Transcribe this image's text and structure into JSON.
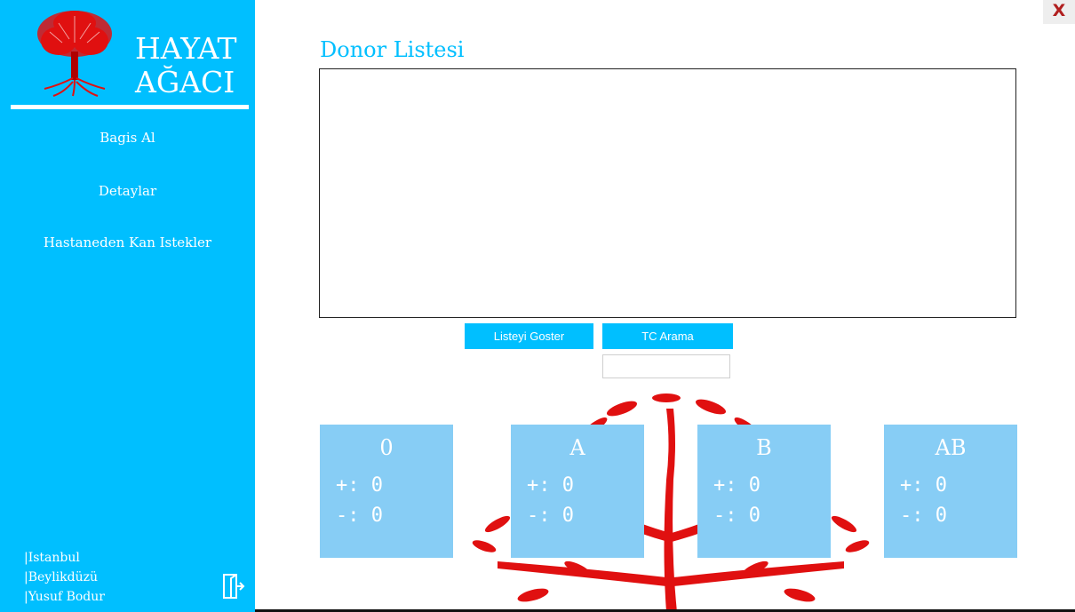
{
  "app": {
    "logo_line1": "HAYAT",
    "logo_line2": "AĞACI"
  },
  "sidebar": {
    "items": [
      {
        "label": "Bagis Al"
      },
      {
        "label": "Detaylar"
      },
      {
        "label": "Hastaneden Kan Istekler"
      }
    ],
    "footer": [
      "Istanbul",
      "Beylikdüzü",
      "Yusuf Bodur"
    ]
  },
  "window": {
    "close_label": "X"
  },
  "main": {
    "title": "Donor Listesi",
    "show_list_button": "Listeyi Goster",
    "tc_search_button": "TC Arama",
    "tc_input_value": ""
  },
  "blood_groups": [
    {
      "name": "0",
      "plus": "+: 0",
      "minus": "-: 0"
    },
    {
      "name": "A",
      "plus": "+: 0",
      "minus": "-: 0"
    },
    {
      "name": "B",
      "plus": "+: 0",
      "minus": "-: 0"
    },
    {
      "name": "AB",
      "plus": "+: 0",
      "minus": "-: 0"
    }
  ],
  "colors": {
    "accent": "#00bfff",
    "card": "#87cdf5",
    "tree": "#e01010",
    "close": "#b01f1f"
  },
  "icons": [
    "tree-logo-icon",
    "exit-door-icon",
    "tree-background-icon"
  ]
}
